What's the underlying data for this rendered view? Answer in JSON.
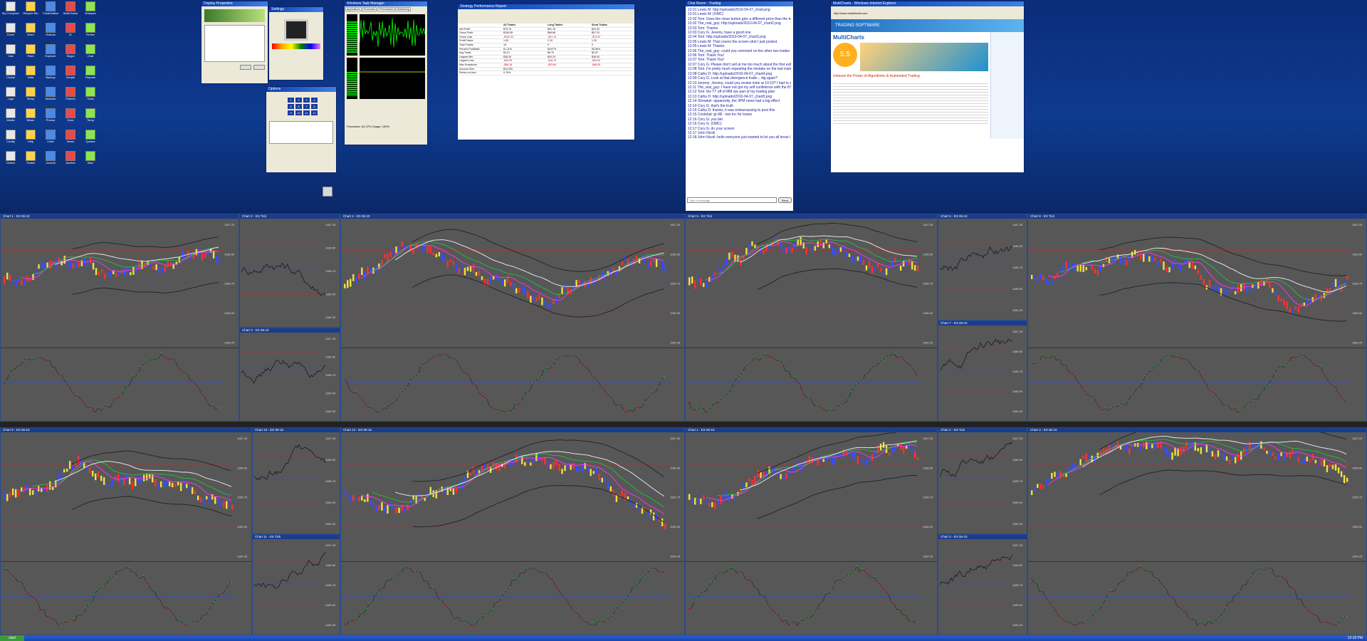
{
  "desktop": {
    "icons": [
      "My Computer",
      "Recycle Bin",
      "TradeStation",
      "MultiCharts",
      "Notepad",
      "Excel",
      "Word",
      "Outlook",
      "IE",
      "Firefox",
      "Calc",
      "Paint",
      "Explorer",
      "Skype",
      "Chat",
      "Charts",
      "Data",
      "Backup",
      "Scripts",
      "Reports",
      "Logs",
      "Setup",
      "Network",
      "Printers",
      "Tools",
      "Media",
      "Music",
      "Photos",
      "Docs",
      "Temp",
      "Config",
      "Help",
      "Links",
      "News",
      "Quotes",
      "Orders",
      "Trades",
      "Journal",
      "Archive",
      "Misc"
    ]
  },
  "windows": {
    "display_props": {
      "title": "Display Properties"
    },
    "monitor_settings": {
      "title": "Settings"
    },
    "keypad": {
      "title": "Options"
    },
    "task_manager": {
      "title": "Windows Task Manager",
      "tabs": [
        "Applications",
        "Processes",
        "Performance",
        "Networking"
      ],
      "cpu_label": "CPU Usage",
      "pf_label": "PF Usage",
      "status": "Processes: 54   CPU Usage: 100%"
    },
    "strategy_report": {
      "title": "Strategy Performance Report",
      "columns": [
        "",
        "All Trades",
        "Long Trades",
        "Short Trades"
      ],
      "rows": [
        [
          "Net Profit",
          "$75.76",
          "$51.76",
          "$24.00"
        ],
        [
          "Gross Profit",
          "$196.08",
          "$98.88",
          "$97.20"
        ],
        [
          "Gross Loss",
          "-$120.32",
          "-$47.12",
          "-$73.20"
        ],
        [
          "Profit Factor",
          "1.63",
          "2.10",
          "1.33"
        ],
        [
          "Total Trades",
          "18",
          "9",
          "9"
        ],
        [
          "Percent Profitable",
          "61.11%",
          "66.67%",
          "55.56%"
        ],
        [
          "Avg Trade",
          "$4.21",
          "$5.75",
          "$2.67"
        ],
        [
          "Largest Win",
          "$38.40",
          "$30.24",
          "$38.40"
        ],
        [
          "Largest Loss",
          "-$24.00",
          "-$18.72",
          "-$24.00"
        ],
        [
          "Max Drawdown",
          "-$56.16",
          "-$33.84",
          "-$48.00"
        ],
        [
          "Account Size",
          "$10,000",
          "",
          ""
        ],
        [
          "Return on Acct",
          "0.76%",
          "",
          ""
        ]
      ]
    },
    "chat": {
      "title": "Chat Room - Trading",
      "lines": [
        "12:01 Lewis M: http://uploads/2010-04-07_chart.png",
        "12:01 Lewis M: (OMC)",
        "12:02 Tom: Does the close button give a different price than the bar",
        "12:02 The_real_guy: http://uploads/2010-04-07_chart2.png",
        "12:03 Tom: Thanks",
        "12:03 Cory G: Jeremy, have a good one",
        "12:04 Tom: http://uploads/2010-04-07_chart3.png",
        "12:05 Lewis M: That covers the screen shot I just posted.",
        "12:05 Lewis M: Thanks",
        "12:06 The_real_guy: could you comment on the other two trades I took on 3/8?",
        "12:06 Tom: Thank You!",
        "12:07 Tom: Thank You!",
        "12:07 Cory G: Please don't yell at me too much about the first exit",
        "12:08 Tom: I'm pretty much repeating the mistake on the last trade",
        "12:08 Cathy D: http://uploads/2010-04-07_chart4.png",
        "12:09 Cory G: Look at that divergence trade... dig again?",
        "12:10 Jeremy: Jeremy, could you review mine at 10:10? I had to step away from the computer",
        "12:11 The_real_guy: I have not got my self confidence with the 87 yet",
        "12:12 Tom: the TT off of MM are part of my trading plan",
        "12:13 Cathy D: http://uploads/2010-04-07_chart5.png",
        "12:14 Shmakel: apparently, the 3PM news had a big effect",
        "12:14 Cory G: that's the truth",
        "12:15 Cathy D: thanks, it was embarrassing to post this",
        "12:15 Cristobal: gt 4R - two tnc for lowes",
        "12:16 Cory G: you bet",
        "12:16 Cory G: (OMC)",
        "12:17 Cory G: do your screen",
        "12:17 John Nicoli",
        "12:18 John Nicoli: hello everyone just wanted to let you all know I have posted April 1st recap on the blog from clones"
      ],
      "input_placeholder": "Type a message",
      "send_label": "Send"
    },
    "browser": {
      "title": "MultiCharts - Windows Internet Explorer",
      "address": "http://www.multicharts.com",
      "logo_text": "MultiCharts",
      "headline": "Unleash the Power of Algorithmic & Automated Trading",
      "banner": "TRADING SOFTWARE",
      "version_badge": "5.5"
    }
  },
  "charts": {
    "title_prefix": "ES 06-10 1 Min",
    "main_titles": [
      "Chart 1 - ES 06-10",
      "Chart 2 - ES Tick",
      "Chart 3 - ES 06-10",
      "Chart 4 - ES 06-10",
      "Chart 5 - ES Tick",
      "Chart 6 - ES 06-10",
      "Chart 7 - ES 06-10",
      "Chart 8 - ES Tick",
      "Chart 9 - ES 06-10",
      "Chart 10 - ES 06-10",
      "Chart 11 - ES Tick",
      "Chart 12 - ES 06-10"
    ],
    "price_labels": [
      "1187.25",
      "1186.50",
      "1185.75",
      "1185.00",
      "1184.25"
    ],
    "colors": {
      "up_bar": "#3a4cff",
      "down_bar": "#ff3030",
      "neutral_bar": "#f0e040",
      "magenta_ma": "#ff30ff",
      "green_ma": "#20c040",
      "white_ma": "#f0f0f0",
      "indicator_up": "#20e040",
      "indicator_down": "#ff3030",
      "bg": "#575757"
    }
  },
  "taskbar": {
    "start_label": "start",
    "clock": "12:18 PM"
  }
}
